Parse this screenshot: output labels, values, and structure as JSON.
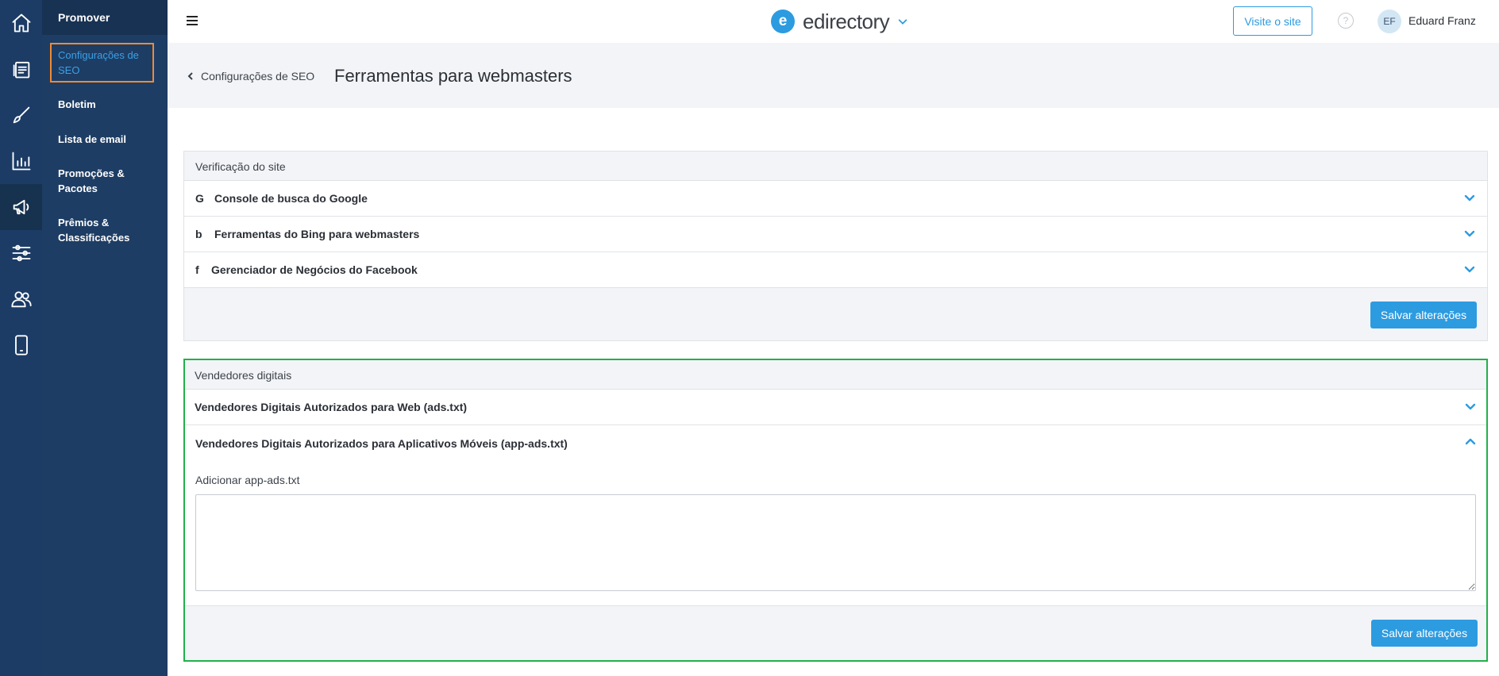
{
  "rail": {
    "items": [
      {
        "icon": "home-icon"
      },
      {
        "icon": "listings-icon"
      },
      {
        "icon": "brush-icon"
      },
      {
        "icon": "chart-icon"
      },
      {
        "icon": "megaphone-icon",
        "active": true
      },
      {
        "icon": "settings-sliders-icon"
      },
      {
        "icon": "users-icon"
      },
      {
        "icon": "mobile-icon"
      }
    ]
  },
  "subnav": {
    "header": "Promover",
    "items": [
      {
        "label": "Configurações de SEO",
        "active": true
      },
      {
        "label": "Boletim"
      },
      {
        "label": "Lista de email"
      },
      {
        "label": "Promoções & Pacotes"
      },
      {
        "label": "Prêmios & Classificações"
      }
    ]
  },
  "topbar": {
    "brand_letter": "e",
    "brand_name": "edirectory",
    "visit_label": "Visite o site",
    "help_glyph": "?",
    "avatar_initials": "EF",
    "user_name": "Eduard Franz"
  },
  "page": {
    "back_label": "Configurações de SEO",
    "title": "Ferramentas para webmasters"
  },
  "verification": {
    "title": "Verificação do site",
    "rows": [
      {
        "glyph": "G",
        "label": "Console de busca do Google"
      },
      {
        "glyph": "b",
        "label": "Ferramentas do Bing para webmasters"
      },
      {
        "glyph": "f",
        "label": "Gerenciador de Negócios do Facebook"
      }
    ],
    "save_label": "Salvar alterações"
  },
  "sellers": {
    "title": "Vendedores digitais",
    "row_web": "Vendedores Digitais Autorizados para Web (ads.txt)",
    "row_app": "Vendedores Digitais Autorizados para Aplicativos Móveis (app-ads.txt)",
    "field_label": "Adicionar app-ads.txt",
    "field_value": "",
    "save_label": "Salvar alterações"
  },
  "colors": {
    "accent": "#2d9be0",
    "rail": "#1c3c66",
    "highlight_active_nav": "#f08a33",
    "highlight_card": "#21b14a"
  }
}
